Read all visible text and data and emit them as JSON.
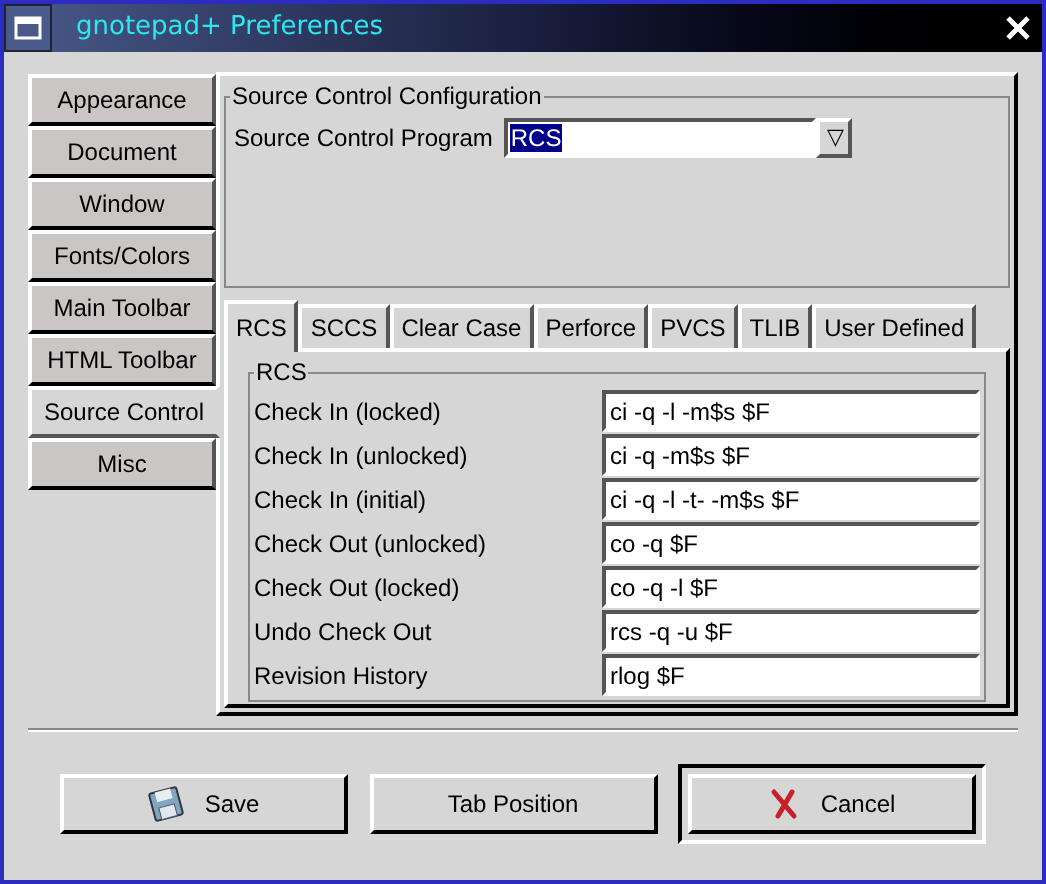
{
  "window": {
    "title": "gnotepad+ Preferences"
  },
  "sidebar": {
    "items": [
      {
        "label": "Appearance",
        "selected": false
      },
      {
        "label": "Document",
        "selected": false
      },
      {
        "label": "Window",
        "selected": false
      },
      {
        "label": "Fonts/Colors",
        "selected": false
      },
      {
        "label": "Main Toolbar",
        "selected": false
      },
      {
        "label": "HTML Toolbar",
        "selected": false
      },
      {
        "label": "Source Control",
        "selected": true
      },
      {
        "label": "Misc",
        "selected": false
      }
    ]
  },
  "config": {
    "title": "Source Control Configuration",
    "label": "Source Control Program",
    "value": "RCS",
    "dropdown_glyph": "▽"
  },
  "tabs": [
    {
      "label": "RCS",
      "selected": true
    },
    {
      "label": "SCCS",
      "selected": false
    },
    {
      "label": "Clear Case",
      "selected": false
    },
    {
      "label": "Perforce",
      "selected": false
    },
    {
      "label": "PVCS",
      "selected": false
    },
    {
      "label": "TLIB",
      "selected": false
    },
    {
      "label": "User Defined",
      "selected": false
    }
  ],
  "commands": {
    "title": "RCS",
    "rows": [
      {
        "label": "Check In (locked)",
        "value": "ci -q -l -m$s $F"
      },
      {
        "label": "Check In (unlocked)",
        "value": "ci -q -m$s $F"
      },
      {
        "label": "Check In (initial)",
        "value": "ci -q -l -t- -m$s $F"
      },
      {
        "label": "Check Out (unlocked)",
        "value": "co -q $F"
      },
      {
        "label": "Check Out (locked)",
        "value": "co -q -l $F"
      },
      {
        "label": "Undo Check Out",
        "value": "rcs -q -u $F"
      },
      {
        "label": "Revision History",
        "value": "rlog $F"
      }
    ]
  },
  "buttons": [
    {
      "label": "Save",
      "kind": "save",
      "default": false
    },
    {
      "label": "Tab Position",
      "kind": "plain",
      "default": false
    },
    {
      "label": "Cancel",
      "kind": "cancel",
      "default": true
    }
  ]
}
